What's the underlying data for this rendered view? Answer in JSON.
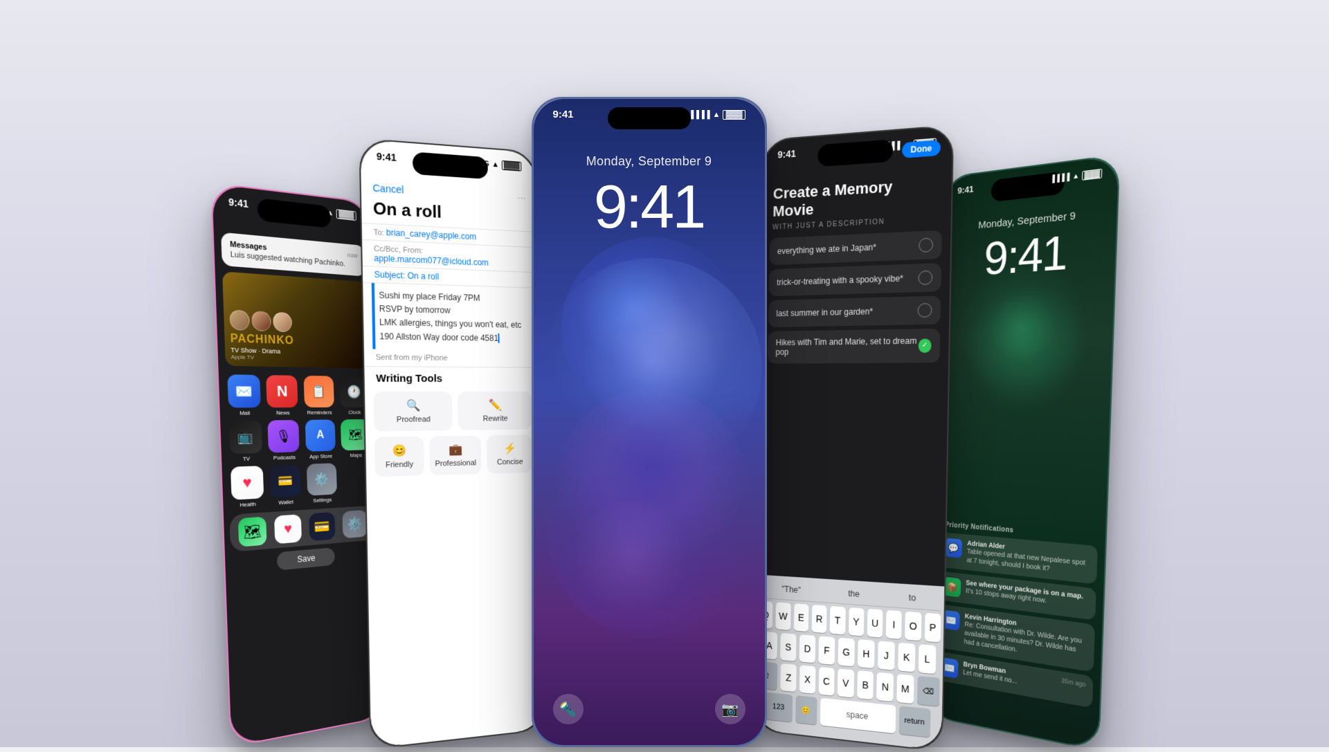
{
  "background": {
    "gradient_start": "#e8e8f0",
    "gradient_end": "#c8c8d8"
  },
  "phones": [
    {
      "id": "phone1",
      "color": "pink",
      "status_time": "9:41",
      "notification": {
        "title": "Luis suggested watching Pachinko.",
        "source": "Messages"
      },
      "tv_show": {
        "title": "PACHINKO",
        "subtitle": "TV Show · Drama",
        "source": "Apple TV"
      },
      "apps": [
        {
          "name": "Mail",
          "icon": "✉️"
        },
        {
          "name": "News",
          "icon": "N"
        },
        {
          "name": "Reminders",
          "icon": "📋"
        },
        {
          "name": "Clock",
          "icon": "🕐"
        },
        {
          "name": "News",
          "icon": "N"
        },
        {
          "name": "TV",
          "icon": "📺"
        },
        {
          "name": "Podcasts",
          "icon": "🎙"
        },
        {
          "name": "App Store",
          "icon": "A"
        },
        {
          "name": "Maps",
          "icon": "🗺"
        },
        {
          "name": "Health",
          "icon": "❤️"
        },
        {
          "name": "Wallet",
          "icon": "💳"
        },
        {
          "name": "Settings",
          "icon": "⚙️"
        }
      ]
    },
    {
      "id": "phone2",
      "color": "dark",
      "status_time": "9:41",
      "email": {
        "cancel_label": "Cancel",
        "subject": "On a roll",
        "to": "brian_carey@apple.com",
        "cc_from": "apple.marcom077@icloud.com",
        "subject_field_label": "Subject: On a roll",
        "body_lines": [
          "Sushi my place Friday 7PM",
          "RSVP by tomorrow",
          "LMK allergies, things you won't eat, etc",
          "190 Allston Way door code 4581"
        ],
        "sent_from": "Sent from my iPhone"
      },
      "writing_tools": {
        "header": "Writing Tools",
        "tools": [
          {
            "icon": "🔍",
            "label": "Proofread"
          },
          {
            "icon": "✏️",
            "label": "Rewrite"
          },
          {
            "icon": "😊",
            "label": "Friendly"
          },
          {
            "icon": "💼",
            "label": "Professional"
          },
          {
            "icon": "⚡",
            "label": "Concise"
          }
        ]
      }
    },
    {
      "id": "phone3",
      "color": "blue",
      "date": "Monday, September 9",
      "time": "9:41"
    },
    {
      "id": "phone4",
      "color": "dark",
      "done_label": "Done",
      "memory_title": "Create a Memory Movie",
      "memory_subtitle": "WITH JUST A DESCRIPTION",
      "prompts": [
        {
          "text": "everything we ate in Japan*",
          "checked": false
        },
        {
          "text": "trick-or-treating with a spooky vibe*",
          "checked": false
        },
        {
          "text": "last summer in our garden*",
          "checked": false
        },
        {
          "text": "Hikes with Tim and Marie, set to dream pop",
          "checked": true
        }
      ],
      "keyboard": {
        "suggestion_bar": [
          "\"The\"",
          "the",
          "to"
        ],
        "rows": [
          [
            "Q",
            "W",
            "E",
            "R",
            "T",
            "Y",
            "U",
            "I",
            "O",
            "P"
          ],
          [
            "A",
            "S",
            "D",
            "F",
            "G",
            "H",
            "J",
            "K",
            "L"
          ],
          [
            "Z",
            "X",
            "C",
            "V",
            "B",
            "N",
            "M"
          ]
        ],
        "typing_text": "\"The\""
      }
    },
    {
      "id": "phone5",
      "color": "teal",
      "date": "Monday, September 9",
      "time": "9:41",
      "priority_label": "↑ Priority Notifications",
      "notifications": [
        {
          "sender": "Adrian Alder",
          "message": "Table opened at that new Nepalese spot at 7 tonight, should I book it?",
          "time": ""
        },
        {
          "sender": "See where your package is on a map.",
          "message": "It's 10 stops away right now.",
          "time": ""
        },
        {
          "sender": "Kevin Harrington",
          "message": "Re: Consultation with Dr. Wilde. Are you available in 30 minutes? Dr. Wilde has had a cancellation.",
          "time": ""
        },
        {
          "sender": "Bryn Bowman",
          "message": "Let me send it no...",
          "time": "35m ago"
        }
      ]
    }
  ]
}
